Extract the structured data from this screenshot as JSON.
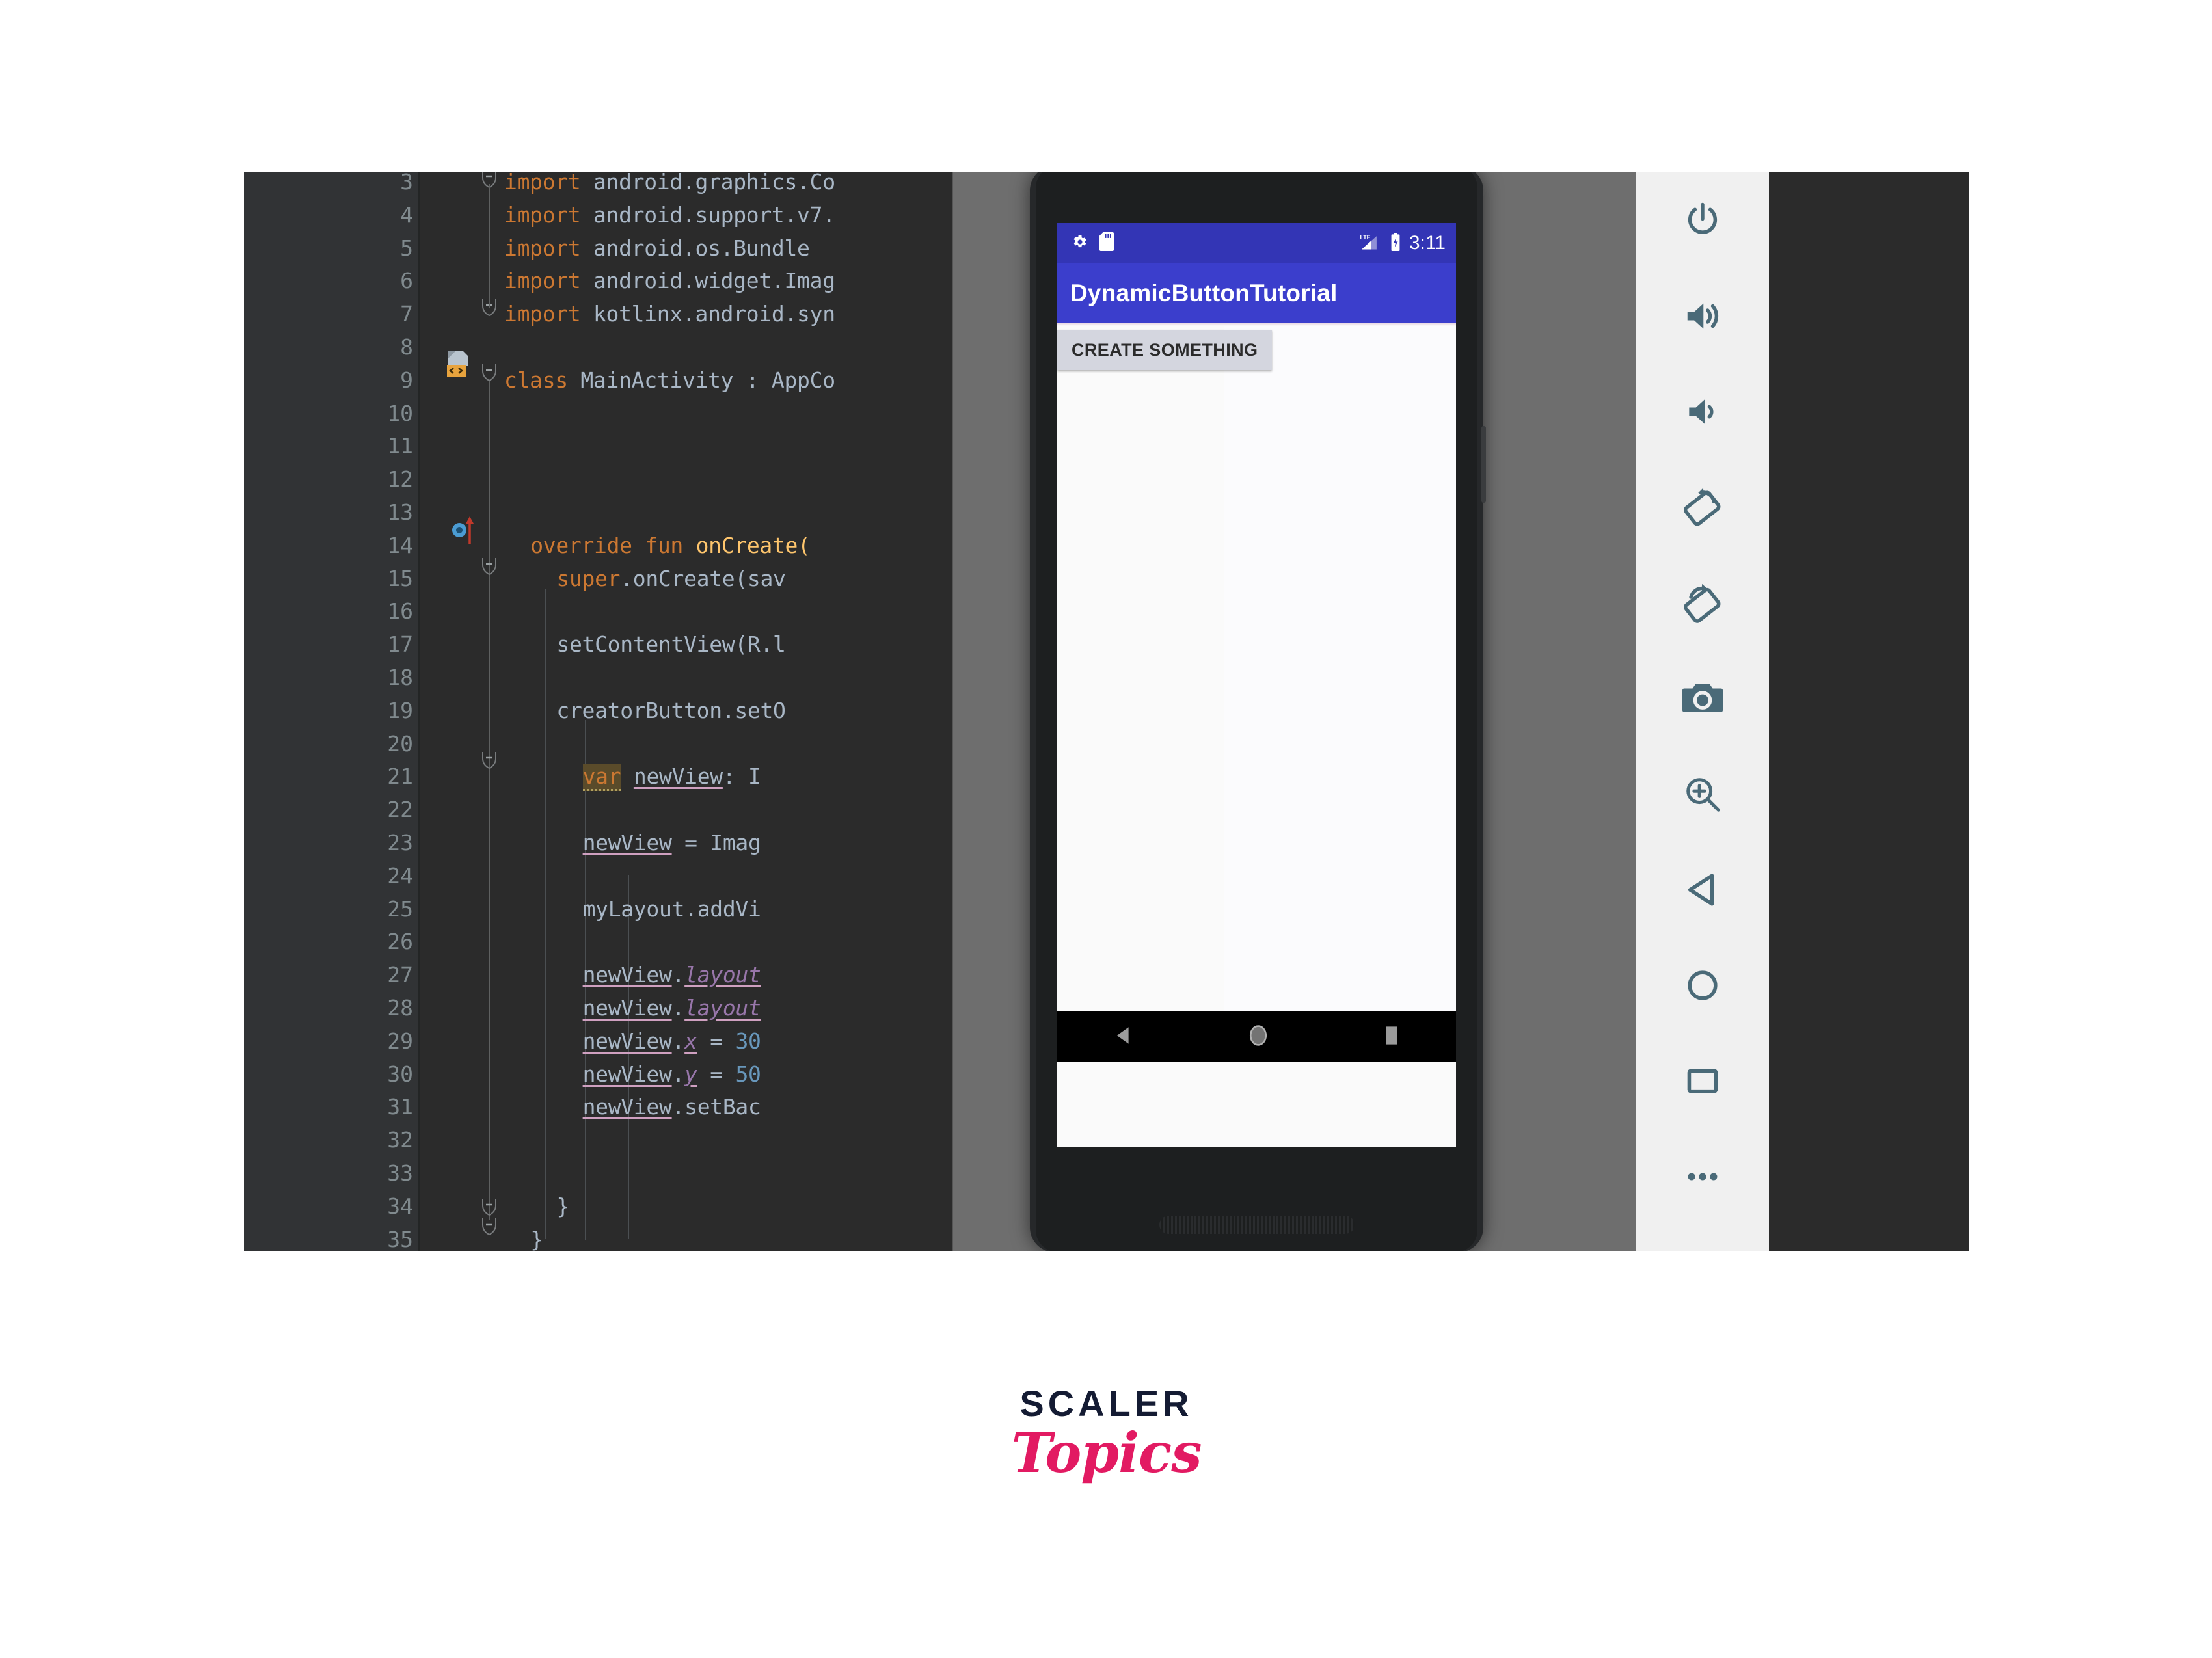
{
  "editor": {
    "name": "kotlin-code-editor",
    "theme_bg": "#2b2b2b",
    "gutter_bg": "#313335",
    "lines": [
      {
        "n": "3",
        "text": "import android.graphics.Co"
      },
      {
        "n": "4",
        "text": "import android.support.v7."
      },
      {
        "n": "5",
        "text": "import android.os.Bundle"
      },
      {
        "n": "6",
        "text": "import android.widget.Imag"
      },
      {
        "n": "7",
        "text": "import kotlinx.android.syn"
      },
      {
        "n": "8",
        "text": ""
      },
      {
        "n": "9",
        "text": "class MainActivity : AppCo"
      },
      {
        "n": "10",
        "text": ""
      },
      {
        "n": "11",
        "text": ""
      },
      {
        "n": "12",
        "text": ""
      },
      {
        "n": "13",
        "text": ""
      },
      {
        "n": "14",
        "text": "override fun onCreate("
      },
      {
        "n": "15",
        "text": "super.onCreate(sav"
      },
      {
        "n": "16",
        "text": ""
      },
      {
        "n": "17",
        "text": "setContentView(R.l"
      },
      {
        "n": "18",
        "text": ""
      },
      {
        "n": "19",
        "text": "creatorButton.setO"
      },
      {
        "n": "20",
        "text": ""
      },
      {
        "n": "21",
        "text": "var newView: I"
      },
      {
        "n": "22",
        "text": ""
      },
      {
        "n": "23",
        "text": "newView = Imag"
      },
      {
        "n": "24",
        "text": ""
      },
      {
        "n": "25",
        "text": "myLayout.addVi"
      },
      {
        "n": "26",
        "text": ""
      },
      {
        "n": "27",
        "text": "newView.layout"
      },
      {
        "n": "28",
        "text": "newView.layout"
      },
      {
        "n": "29",
        "text": "newView.x = 30"
      },
      {
        "n": "30",
        "text": "newView.y = 50"
      },
      {
        "n": "31",
        "text": "newView.setBac"
      },
      {
        "n": "32",
        "text": ""
      },
      {
        "n": "33",
        "text": ""
      },
      {
        "n": "34",
        "text": "}"
      },
      {
        "n": "35",
        "text": "}"
      }
    ],
    "gutter_icons": [
      {
        "line": "9",
        "icon": "kotlin-class-icon"
      },
      {
        "line": "14",
        "icon": "override-method-icon"
      }
    ]
  },
  "emulator": {
    "device_name": "android-phone-emulator",
    "status_bar": {
      "gear_icon": "gear-icon",
      "sdcard_icon": "sdcard-icon",
      "network": "LTE",
      "battery_icon": "battery-charging-icon",
      "time": "3:11"
    },
    "app_bar": {
      "title": "DynamicButtonTutorial",
      "bg": "#3b3ecc"
    },
    "app_content": {
      "button_label": "CREATE SOMETHING",
      "bg": "#fbfbfd"
    },
    "nav_bar": {
      "back_icon": "back-triangle-icon",
      "home_icon": "home-circle-icon",
      "recents_icon": "recents-square-icon"
    },
    "cursor": "mouse-pointer"
  },
  "toolbar": {
    "name": "emulator-side-toolbar",
    "bg": "#f0f0f0",
    "icon_color": "#4a6a78",
    "buttons": [
      {
        "name": "power-icon",
        "label": "Power"
      },
      {
        "name": "volume-up-icon",
        "label": "Volume Up"
      },
      {
        "name": "volume-down-icon",
        "label": "Volume Down"
      },
      {
        "name": "rotate-left-icon",
        "label": "Rotate Left"
      },
      {
        "name": "rotate-right-icon",
        "label": "Rotate Right"
      },
      {
        "name": "camera-icon",
        "label": "Take Screenshot"
      },
      {
        "name": "zoom-in-icon",
        "label": "Zoom"
      },
      {
        "name": "back-icon",
        "label": "Back"
      },
      {
        "name": "home-icon",
        "label": "Home"
      },
      {
        "name": "overview-icon",
        "label": "Overview"
      },
      {
        "name": "more-icon",
        "label": "More"
      }
    ]
  },
  "branding": {
    "primary": "SCALER",
    "secondary": "Topics",
    "primary_color": "#141b33",
    "secondary_color": "#e21a62"
  }
}
